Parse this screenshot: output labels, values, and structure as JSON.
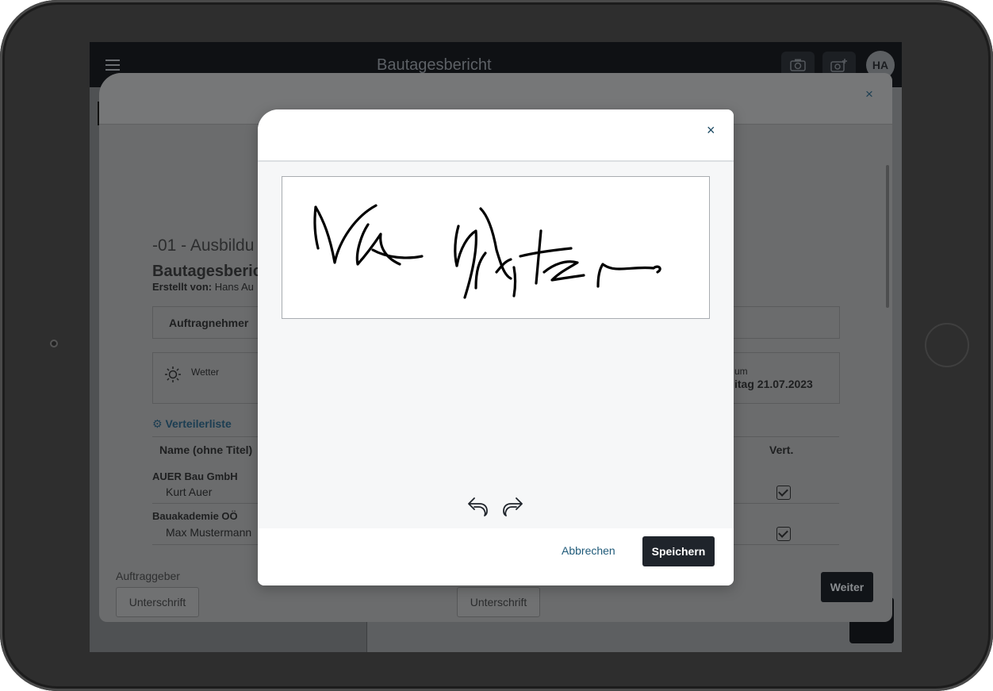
{
  "app": {
    "title": "Bautagesbericht",
    "avatar_initials": "HA",
    "camera_icon": "camera-icon",
    "camera_add_icon": "camera-add-icon"
  },
  "report": {
    "project_title": "-01 - Ausbildu",
    "report_title": "Bautagesberic",
    "created_by_label": "Erstellt von:",
    "created_by_value": "Hans Au",
    "contractor_label": "Auftragnehmer",
    "weather_label": "Wetter",
    "date_label_fragment": "um",
    "date_value_fragment": "itag 21.07.2023",
    "distribution_link": "Verteilerliste",
    "table": {
      "col_name": "Name (ohne Titel)",
      "col_vert": "Vert.",
      "rows": [
        {
          "company": "AUER Bau GmbH",
          "person": "Kurt Auer",
          "checked": true
        },
        {
          "company": "Bauakademie OÖ",
          "person": "Max Mustermann",
          "checked": true
        }
      ]
    },
    "client_label": "Auftraggeber",
    "signature_button": "Unterschrift",
    "signature_button_2": "Unterschrift",
    "next_button": "Weiter"
  },
  "signature_dialog": {
    "close_symbol": "×",
    "cancel_label": "Abbrechen",
    "save_label": "Speichern",
    "signature_text_drawn": "Max Muster"
  },
  "outer_dialog": {
    "close_symbol": "×"
  },
  "colors": {
    "primary_dark": "#1f242b",
    "link_blue": "#1f5a79",
    "border": "#a9adb1"
  }
}
